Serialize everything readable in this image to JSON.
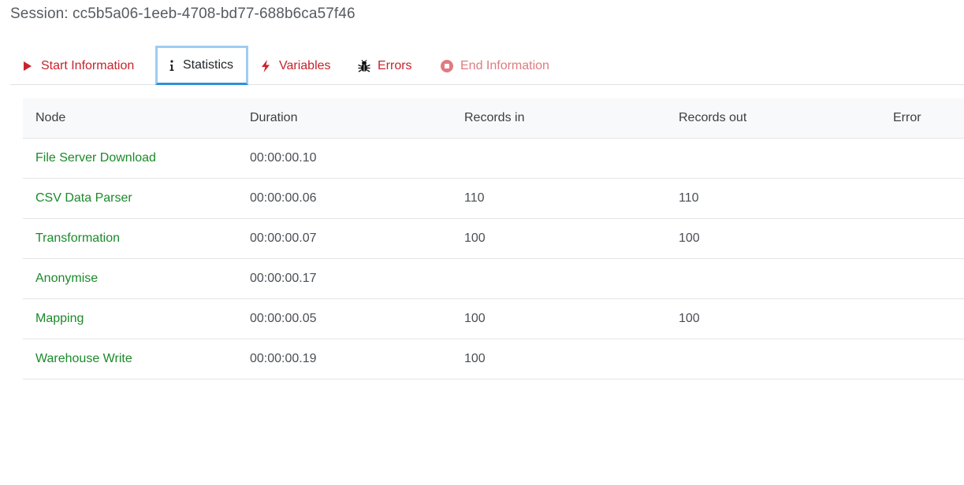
{
  "session": {
    "title": "Session: cc5b5a06-1eeb-4708-bd77-688b6ca57f46"
  },
  "tabs": [
    {
      "label": "Start Information",
      "icon": "play-icon",
      "active": false
    },
    {
      "label": "Statistics",
      "icon": "info-icon",
      "active": true
    },
    {
      "label": "Variables",
      "icon": "lightning-icon",
      "active": false
    },
    {
      "label": "Errors",
      "icon": "bug-icon",
      "active": false
    },
    {
      "label": "End Information",
      "icon": "stop-circle-icon",
      "active": false
    }
  ],
  "colors": {
    "tab_text": "#c8232c",
    "tab_text_disabled": "#e07b7f",
    "active_border": "#9ecdf2",
    "active_underline": "#2f8fd8",
    "node_link": "#1a8a2a",
    "header_bg": "#f8f9fa"
  },
  "table": {
    "headers": [
      "Node",
      "Duration",
      "Records in",
      "Records out",
      "Error"
    ],
    "rows": [
      {
        "node": "File Server Download",
        "duration": "00:00:00.10",
        "records_in": "",
        "records_out": "",
        "error": ""
      },
      {
        "node": "CSV Data Parser",
        "duration": "00:00:00.06",
        "records_in": "110",
        "records_out": "110",
        "error": ""
      },
      {
        "node": "Transformation",
        "duration": "00:00:00.07",
        "records_in": "100",
        "records_out": "100",
        "error": ""
      },
      {
        "node": "Anonymise",
        "duration": "00:00:00.17",
        "records_in": "",
        "records_out": "",
        "error": ""
      },
      {
        "node": "Mapping",
        "duration": "00:00:00.05",
        "records_in": "100",
        "records_out": "100",
        "error": ""
      },
      {
        "node": "Warehouse Write",
        "duration": "00:00:00.19",
        "records_in": "100",
        "records_out": "",
        "error": ""
      }
    ]
  }
}
